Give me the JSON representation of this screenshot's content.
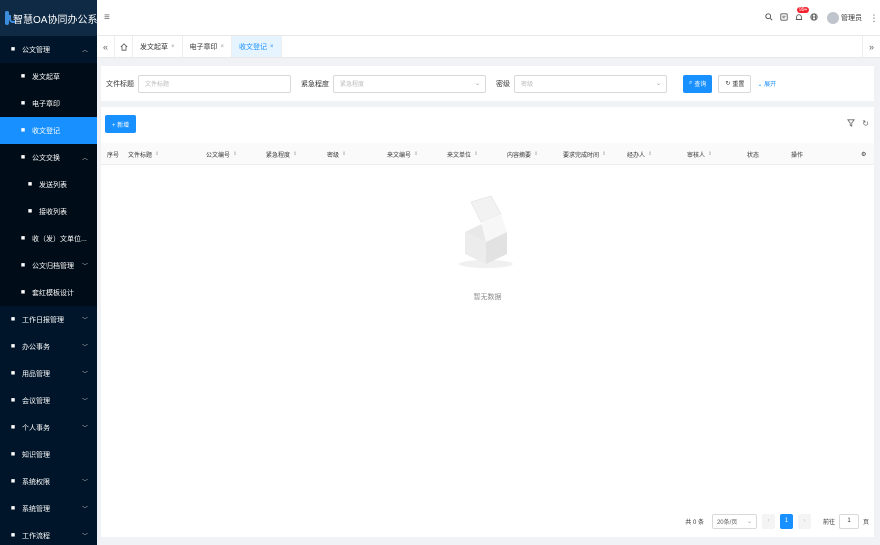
{
  "app": {
    "title": "智慧OA协同办公系统"
  },
  "sidebar": {
    "items": [
      {
        "label": "公文管理",
        "arrow": "^",
        "level": 0,
        "icon": "document-icon"
      },
      {
        "label": "发文起草",
        "level": 1,
        "icon": "edit-icon"
      },
      {
        "label": "电子章印",
        "level": 1,
        "icon": "user-icon"
      },
      {
        "label": "收文登记",
        "level": 1,
        "icon": "file-icon",
        "active": true
      },
      {
        "label": "公文交换",
        "arrow": "^",
        "level": 1,
        "icon": "exchange-icon"
      },
      {
        "label": "发送列表",
        "level": 2,
        "icon": "send-icon"
      },
      {
        "label": "接收列表",
        "level": 2,
        "icon": "inbox-icon"
      },
      {
        "label": "收（发）文单位...",
        "level": 1,
        "icon": "org-icon"
      },
      {
        "label": "公文归档管理",
        "arrow": "v",
        "level": 1,
        "icon": "archive-icon"
      },
      {
        "label": "套红模板设计",
        "level": 1,
        "icon": "template-icon"
      },
      {
        "label": "工作日报管理",
        "arrow": "v",
        "level": 0,
        "icon": "report-icon"
      },
      {
        "label": "办公事务",
        "arrow": "v",
        "level": 0,
        "icon": "office-icon"
      },
      {
        "label": "用品管理",
        "arrow": "v",
        "level": 0,
        "icon": "grid-icon"
      },
      {
        "label": "会议管理",
        "arrow": "v",
        "level": 0,
        "icon": "meeting-icon"
      },
      {
        "label": "个人事务",
        "arrow": "v",
        "level": 0,
        "icon": "person-icon"
      },
      {
        "label": "知识管理",
        "level": 0,
        "icon": "book-icon"
      },
      {
        "label": "系统权限",
        "arrow": "v",
        "level": 0,
        "icon": "shield-icon"
      },
      {
        "label": "系统管理",
        "arrow": "v",
        "level": 0,
        "icon": "gear-icon"
      },
      {
        "label": "工作流程",
        "arrow": "v",
        "level": 0,
        "icon": "flow-icon"
      }
    ]
  },
  "header": {
    "fold_icon": "≡",
    "badge": "99+",
    "user": "管理员"
  },
  "tabs": [
    {
      "label": "发文起草"
    },
    {
      "label": "电子章印"
    },
    {
      "label": "收文登记",
      "active": true
    }
  ],
  "search": {
    "file_title_label": "文件标题",
    "file_title_placeholder": "文件标题",
    "urgency_label": "紧急程度",
    "urgency_placeholder": "紧急程度",
    "secret_label": "密级",
    "secret_placeholder": "密级",
    "query_button": "查询",
    "reset_button": "重置",
    "expand_link": "展开"
  },
  "table": {
    "add_button": "+ 新增",
    "columns": [
      "序号",
      "文件标题",
      "公文编号",
      "紧急程度",
      "密级",
      "来文编号",
      "来文单位",
      "内容摘要",
      "要求完成时间",
      "经办人",
      "审核人",
      "状态",
      "操作"
    ],
    "empty_text": "暂无数据"
  },
  "pagination": {
    "total": "共 0 条",
    "page_size": "20条/页",
    "current_page": "1",
    "goto_label": "前往",
    "goto_value": "1",
    "page_unit": "页"
  }
}
